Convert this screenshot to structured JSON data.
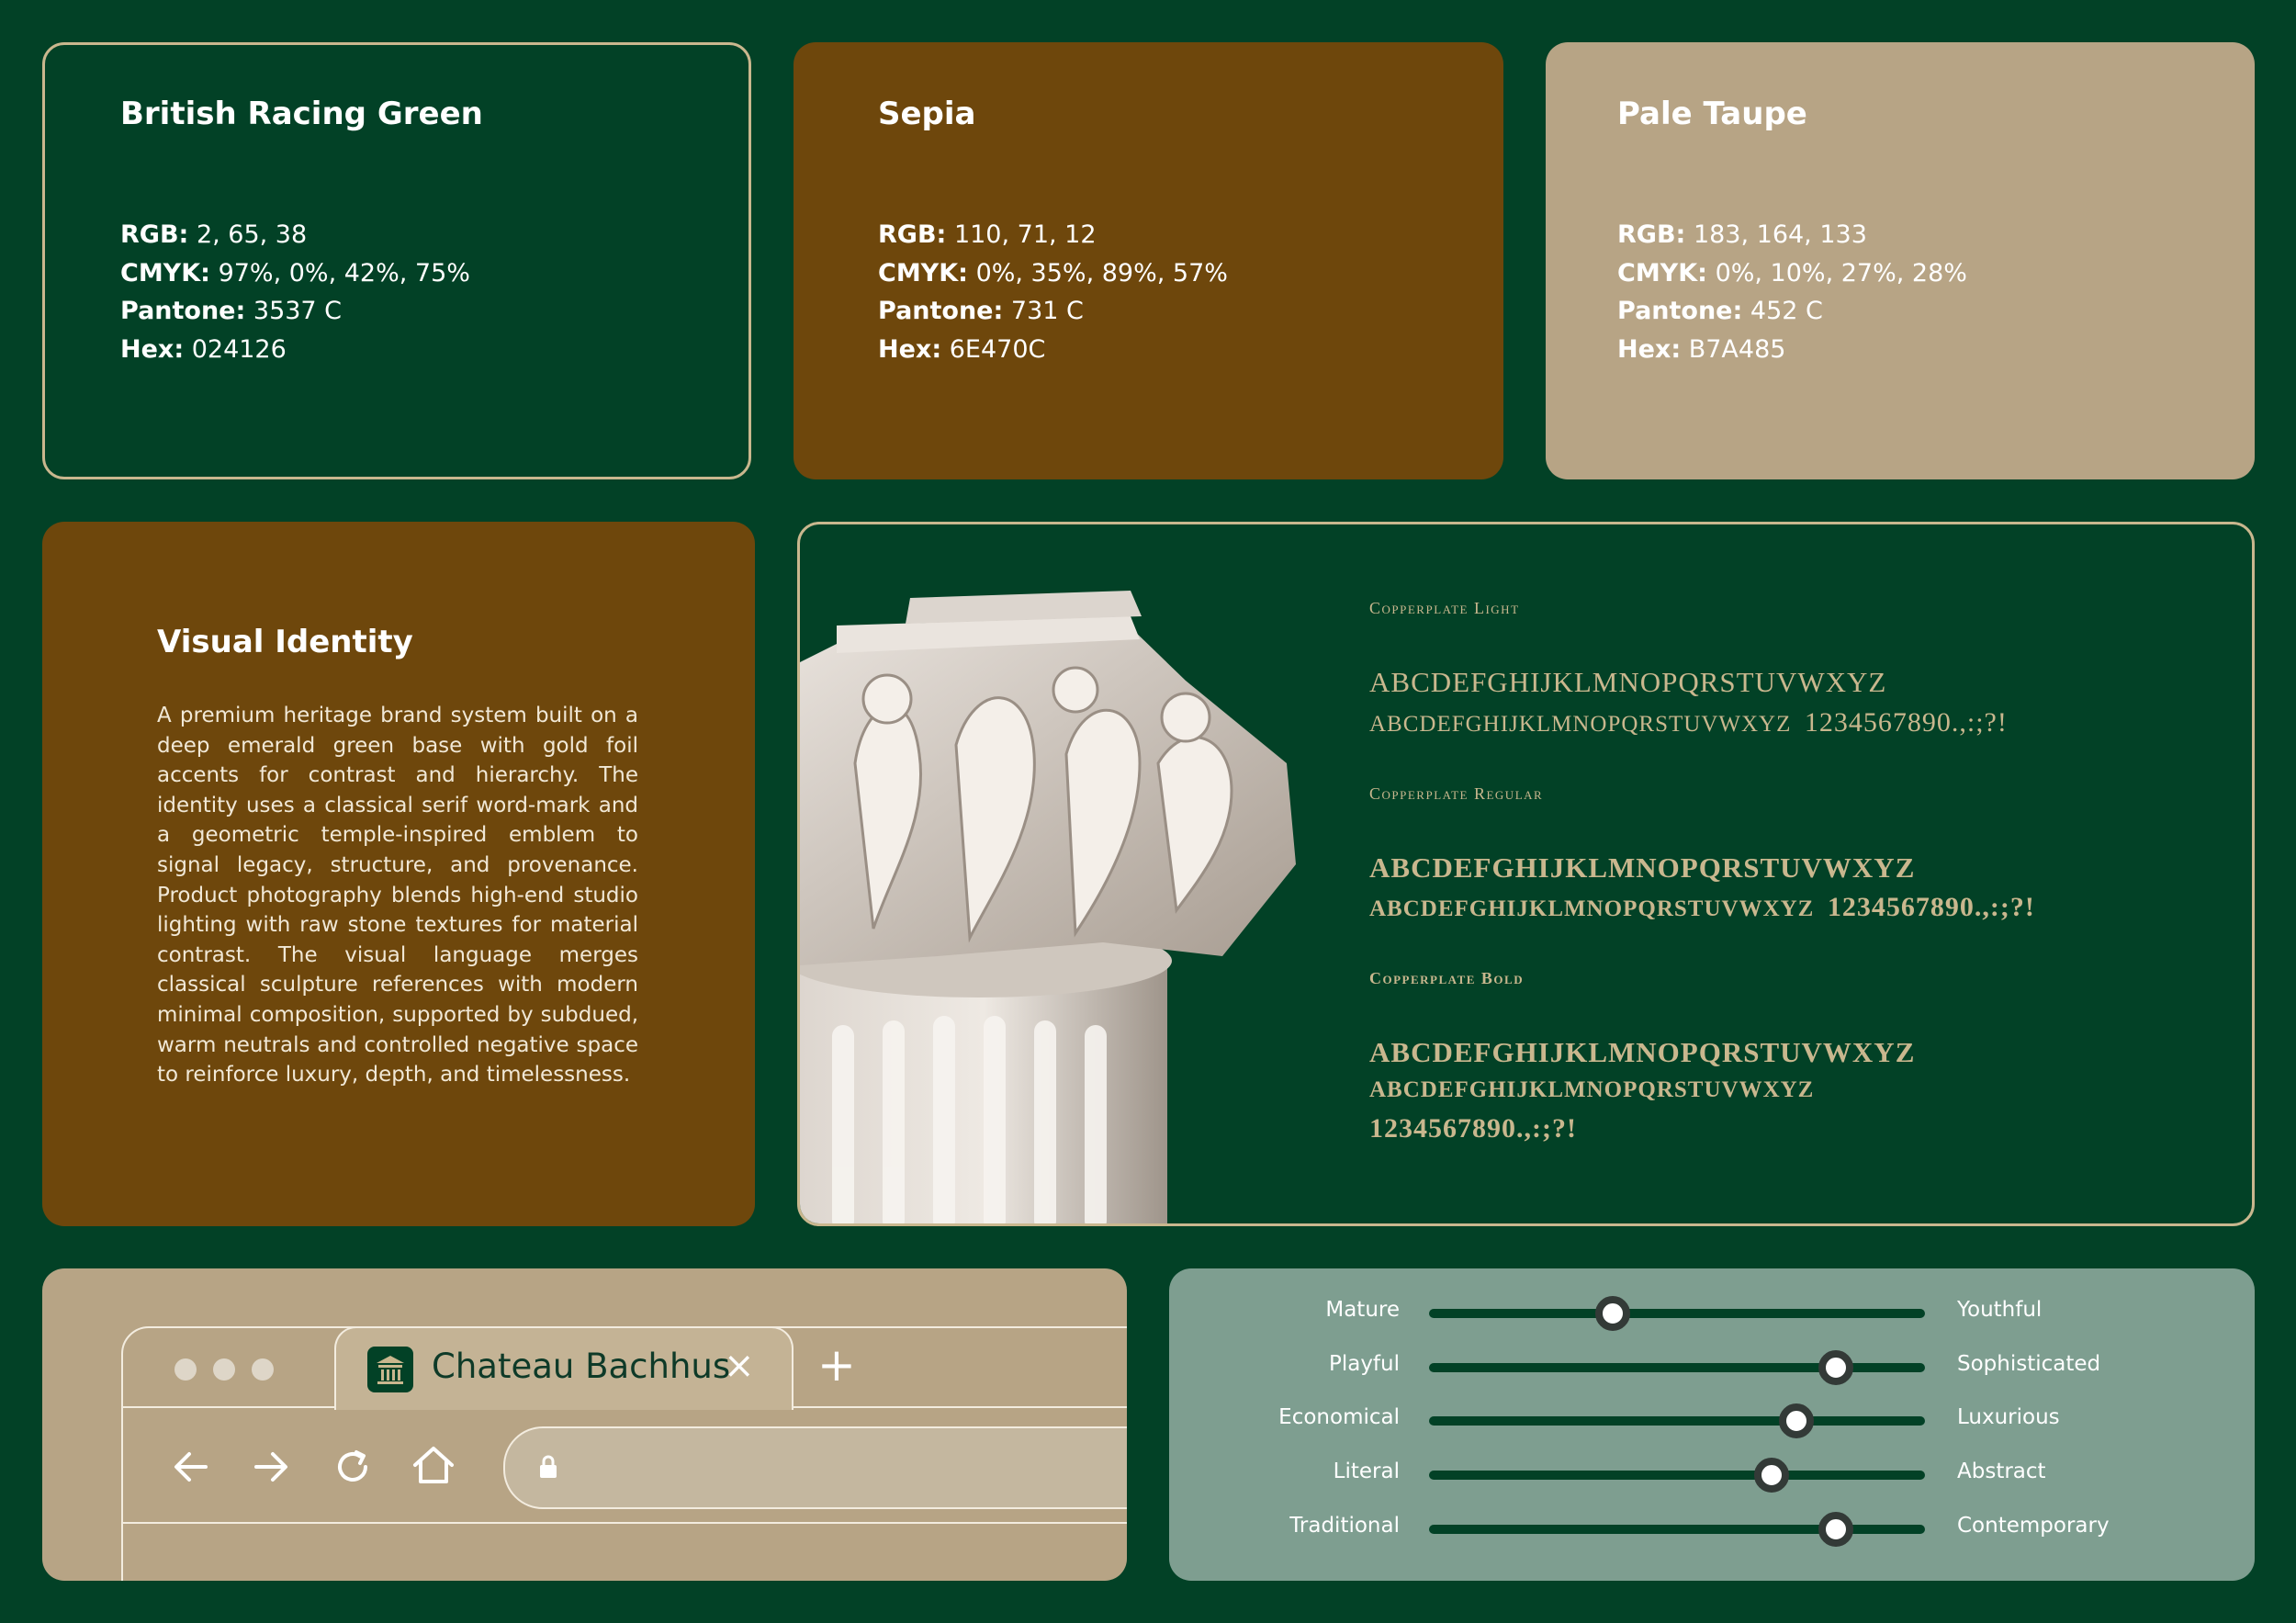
{
  "swatches": [
    {
      "name": "British Racing Green",
      "rgb": "2, 65, 38",
      "cmyk": "97%, 0%, 42%, 75%",
      "pantone": "3537 C",
      "hex": "024126",
      "color": "#024126"
    },
    {
      "name": "Sepia",
      "rgb": "110, 71, 12",
      "cmyk": "0%, 35%, 89%, 57%",
      "pantone": "731 C",
      "hex": "6E470C",
      "color": "#6E470C"
    },
    {
      "name": "Pale Taupe",
      "rgb": "183, 164, 133",
      "cmyk": "0%, 10%, 27%, 28%",
      "pantone": "452 C",
      "hex": "B7A485",
      "color": "#B7A485"
    }
  ],
  "spec_labels": {
    "rgb": "RGB:",
    "cmyk": "CMYK:",
    "pantone": "Pantone:",
    "hex": "Hex:"
  },
  "visual_identity": {
    "title": "Visual Identity",
    "body": "A premium heritage brand system built on a deep emerald green base with gold foil accents for contrast and hierarchy. The identity uses a classical serif word-mark and a geometric temple-inspired emblem to signal legacy, structure, and provenance. Product photography blends high-end studio lighting with raw stone textures for material contrast. The visual language merges classical sculpture references with modern minimal composition, supported by subdued, warm neutrals and controlled negative space to reinforce luxury, depth, and timelessness."
  },
  "typography": [
    {
      "label": "Copperplate Light",
      "upper": "ABCDEFGHIJKLMNOPQRSTUVWXYZ",
      "lower": "ABCDEFGHIJKLMNOPQRSTUVWXYZ",
      "digits": "1234567890.,:;?!"
    },
    {
      "label": "Copperplate Regular",
      "upper": "ABCDEFGHIJKLMNOPQRSTUVWXYZ",
      "lower": "ABCDEFGHIJKLMNOPQRSTUVWXYZ",
      "digits": "1234567890.,:;?!"
    },
    {
      "label": "Copperplate Bold",
      "upper": "ABCDEFGHIJKLMNOPQRSTUVWXYZ",
      "lower": "ABCDEFGHIJKLMNOPQRSTUVWXYZ",
      "digits": "1234567890.,:;?!"
    }
  ],
  "browser": {
    "tab_title": "Chateau Bachhus",
    "close_glyph": "×",
    "new_tab_glyph": "+"
  },
  "personality": [
    {
      "left": "Mature",
      "right": "Youthful",
      "value": 0.37
    },
    {
      "left": "Playful",
      "right": "Sophisticated",
      "value": 0.82
    },
    {
      "left": "Economical",
      "right": "Luxurious",
      "value": 0.74
    },
    {
      "left": "Literal",
      "right": "Abstract",
      "value": 0.69
    },
    {
      "left": "Traditional",
      "right": "Contemporary",
      "value": 0.82
    }
  ],
  "colors": {
    "background": "#024126",
    "sepia": "#6E470C",
    "taupe": "#B7A485",
    "sage": "#7E9E90",
    "gold": "#C9B78E"
  }
}
